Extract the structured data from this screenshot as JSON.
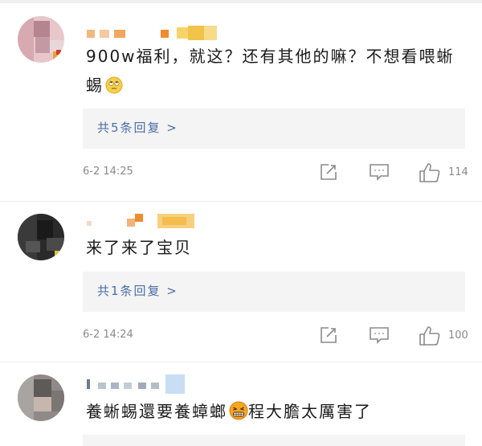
{
  "comments": [
    {
      "text": "900w福利，就这？还有其他的嘛？不想看喂蜥蜴",
      "emoji_icon": "rolling-eyes-emoji",
      "replies_label": "共5条回复 >",
      "time": "6-2 14:25",
      "like_count": "114"
    },
    {
      "text": "来了来了宝贝",
      "replies_label": "共1条回复 >",
      "time": "6-2 14:24",
      "like_count": "100"
    },
    {
      "text_before": "養蜥蜴還要養蟑螂",
      "emoji_icon": "grimacing-emoji",
      "text_after": "程大膽太厲害了"
    }
  ],
  "icons": {
    "share": "share-edit-icon",
    "comment": "comment-icon",
    "like": "thumbs-up-icon"
  },
  "colors": {
    "link": "#4a6ea8",
    "meta": "#8a8a8a",
    "reply_bg": "#f4f4f4"
  }
}
